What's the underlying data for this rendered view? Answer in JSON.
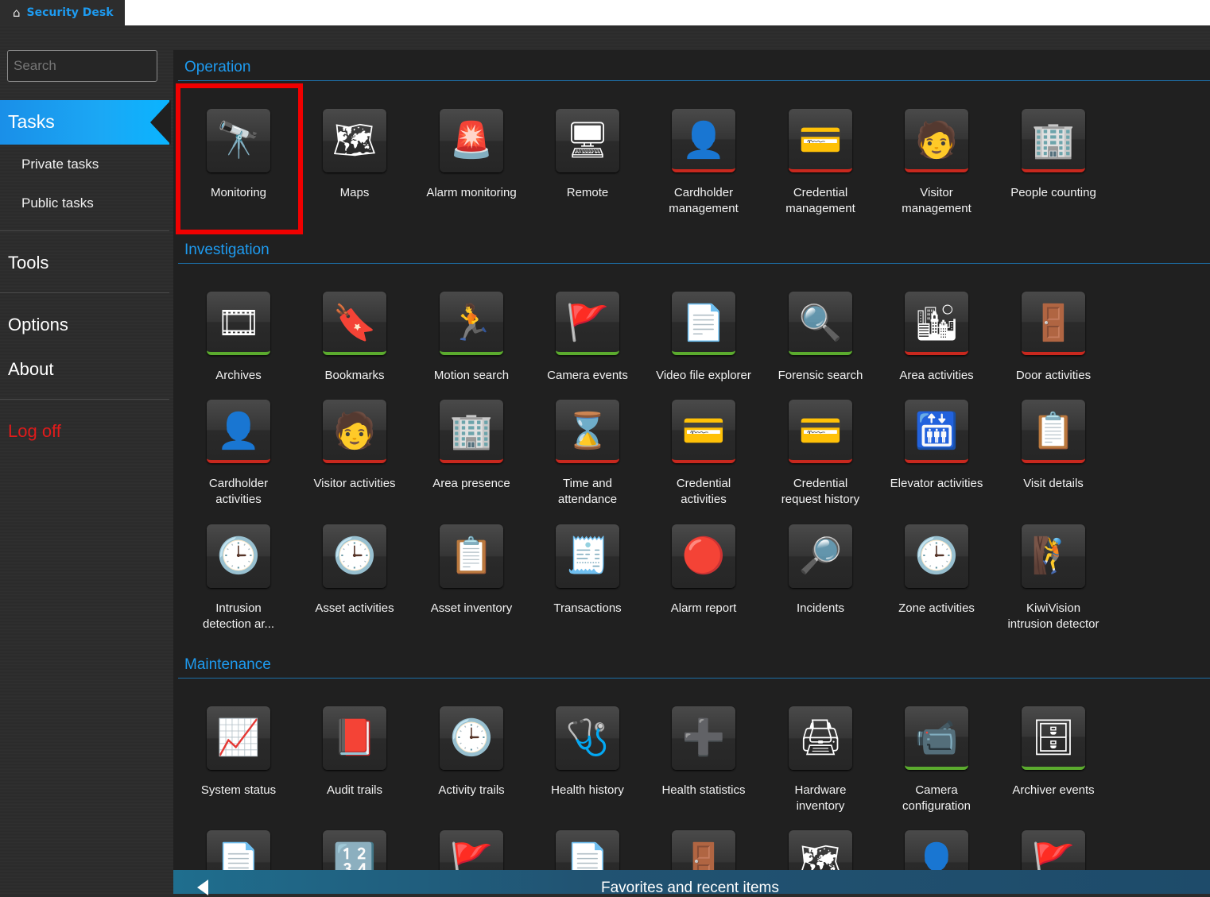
{
  "app": {
    "title": "Security Desk",
    "home_icon": "home-icon"
  },
  "sidebar": {
    "search_placeholder": "Search",
    "tasks": "Tasks",
    "private_tasks": "Private tasks",
    "public_tasks": "Public tasks",
    "tools": "Tools",
    "options": "Options",
    "about": "About",
    "log_off": "Log off"
  },
  "sections": [
    {
      "title": "Operation",
      "rows": [
        [
          {
            "label": "Monitoring",
            "icon": "binoculars-video-icon",
            "accent": "none",
            "glyph": "🔭"
          },
          {
            "label": "Maps",
            "icon": "map-binoculars-icon",
            "accent": "none",
            "glyph": "🗺"
          },
          {
            "label": "Alarm monitoring",
            "icon": "alarm-binoculars-icon",
            "accent": "none",
            "glyph": "🚨"
          },
          {
            "label": "Remote",
            "icon": "remote-monitor-icon",
            "accent": "none",
            "glyph": "🖥"
          },
          {
            "label": "Cardholder management",
            "icon": "cardholder-icon",
            "accent": "red",
            "glyph": "👤"
          },
          {
            "label": "Credential management",
            "icon": "credential-card-icon",
            "accent": "red",
            "glyph": "💳"
          },
          {
            "label": "Visitor management",
            "icon": "visitor-icon",
            "accent": "red",
            "glyph": "🧑"
          },
          {
            "label": "People counting",
            "icon": "people-counting-icon",
            "accent": "red",
            "glyph": "🏢"
          }
        ]
      ]
    },
    {
      "title": "Investigation",
      "rows": [
        [
          {
            "label": "Archives",
            "icon": "film-reel-search-icon",
            "accent": "green",
            "glyph": "🎞"
          },
          {
            "label": "Bookmarks",
            "icon": "bookmark-reel-icon",
            "accent": "green",
            "glyph": "🔖"
          },
          {
            "label": "Motion search",
            "icon": "motion-search-icon",
            "accent": "green",
            "glyph": "🏃"
          },
          {
            "label": "Camera events",
            "icon": "camera-flag-icon",
            "accent": "green",
            "glyph": "🚩"
          },
          {
            "label": "Video file explorer",
            "icon": "video-file-search-icon",
            "accent": "green",
            "glyph": "📄"
          },
          {
            "label": "Forensic search",
            "icon": "fingerprint-search-icon",
            "accent": "green",
            "glyph": "🔍"
          },
          {
            "label": "Area activities",
            "icon": "area-clock-icon",
            "accent": "red",
            "glyph": "🏙"
          },
          {
            "label": "Door activities",
            "icon": "door-clock-icon",
            "accent": "red",
            "glyph": "🚪"
          }
        ],
        [
          {
            "label": "Cardholder activities",
            "icon": "cardholder-clock-icon",
            "accent": "red",
            "glyph": "👤"
          },
          {
            "label": "Visitor activities",
            "icon": "visitor-clock-icon",
            "accent": "red",
            "glyph": "🧑"
          },
          {
            "label": "Area presence",
            "icon": "area-presence-icon",
            "accent": "red",
            "glyph": "🏢"
          },
          {
            "label": "Time and attendance",
            "icon": "hourglass-calendar-icon",
            "accent": "red",
            "glyph": "⌛"
          },
          {
            "label": "Credential activities",
            "icon": "credential-clock-icon",
            "accent": "red",
            "glyph": "💳"
          },
          {
            "label": "Credential request history",
            "icon": "credential-request-icon",
            "accent": "red",
            "glyph": "💳"
          },
          {
            "label": "Elevator activities",
            "icon": "elevator-clock-icon",
            "accent": "red",
            "glyph": "🛗"
          },
          {
            "label": "Visit details",
            "icon": "visit-details-icon",
            "accent": "red",
            "glyph": "📋"
          }
        ],
        [
          {
            "label": "Intrusion detection ar...",
            "icon": "intrusion-clock-icon",
            "accent": "none",
            "glyph": "🕒"
          },
          {
            "label": "Asset activities",
            "icon": "asset-barcode-clock-icon",
            "accent": "none",
            "glyph": "🕒"
          },
          {
            "label": "Asset inventory",
            "icon": "barcode-clipboard-icon",
            "accent": "none",
            "glyph": "📋"
          },
          {
            "label": "Transactions",
            "icon": "transactions-icon",
            "accent": "none",
            "glyph": "🧾"
          },
          {
            "label": "Alarm report",
            "icon": "alarm-report-icon",
            "accent": "none",
            "glyph": "🔴"
          },
          {
            "label": "Incidents",
            "icon": "incidents-icon",
            "accent": "none",
            "glyph": "🔎"
          },
          {
            "label": "Zone activities",
            "icon": "zone-clock-icon",
            "accent": "none",
            "glyph": "🕒"
          },
          {
            "label": "KiwiVision intrusion detector",
            "icon": "intrusion-detector-icon",
            "accent": "none",
            "glyph": "🧗"
          }
        ]
      ]
    },
    {
      "title": "Maintenance",
      "rows": [
        [
          {
            "label": "System status",
            "icon": "heartbeat-monitor-icon",
            "accent": "none",
            "glyph": "📈"
          },
          {
            "label": "Audit trails",
            "icon": "audit-book-icon",
            "accent": "none",
            "glyph": "📕"
          },
          {
            "label": "Activity trails",
            "icon": "activity-clock-icon",
            "accent": "none",
            "glyph": "🕒"
          },
          {
            "label": "Health history",
            "icon": "health-calendar-icon",
            "accent": "none",
            "glyph": "🩺"
          },
          {
            "label": "Health statistics",
            "icon": "health-pie-icon",
            "accent": "none",
            "glyph": "➕"
          },
          {
            "label": "Hardware inventory",
            "icon": "hardware-icon",
            "accent": "none",
            "glyph": "🖨"
          },
          {
            "label": "Camera configuration",
            "icon": "camera-config-icon",
            "accent": "green",
            "glyph": "📹"
          },
          {
            "label": "Archiver events",
            "icon": "archiver-flag-icon",
            "accent": "green",
            "glyph": "🗄"
          }
        ],
        [
          {
            "label": "",
            "icon": "video-file-icon",
            "accent": "none",
            "glyph": "📄"
          },
          {
            "label": "",
            "icon": "keypad-icon",
            "accent": "none",
            "glyph": "🔢"
          },
          {
            "label": "",
            "icon": "flag-icon",
            "accent": "none",
            "glyph": "🚩"
          },
          {
            "label": "",
            "icon": "report-icon",
            "accent": "none",
            "glyph": "📄"
          },
          {
            "label": "",
            "icon": "door-icon",
            "accent": "none",
            "glyph": "🚪"
          },
          {
            "label": "",
            "icon": "unit-map-icon",
            "accent": "none",
            "glyph": "🗺"
          },
          {
            "label": "",
            "icon": "unit-person-icon",
            "accent": "none",
            "glyph": "👤"
          },
          {
            "label": "",
            "icon": "unit-flag-icon",
            "accent": "none",
            "glyph": "🚩"
          }
        ]
      ]
    }
  ],
  "favorites": {
    "label": "Favorites and recent items"
  }
}
